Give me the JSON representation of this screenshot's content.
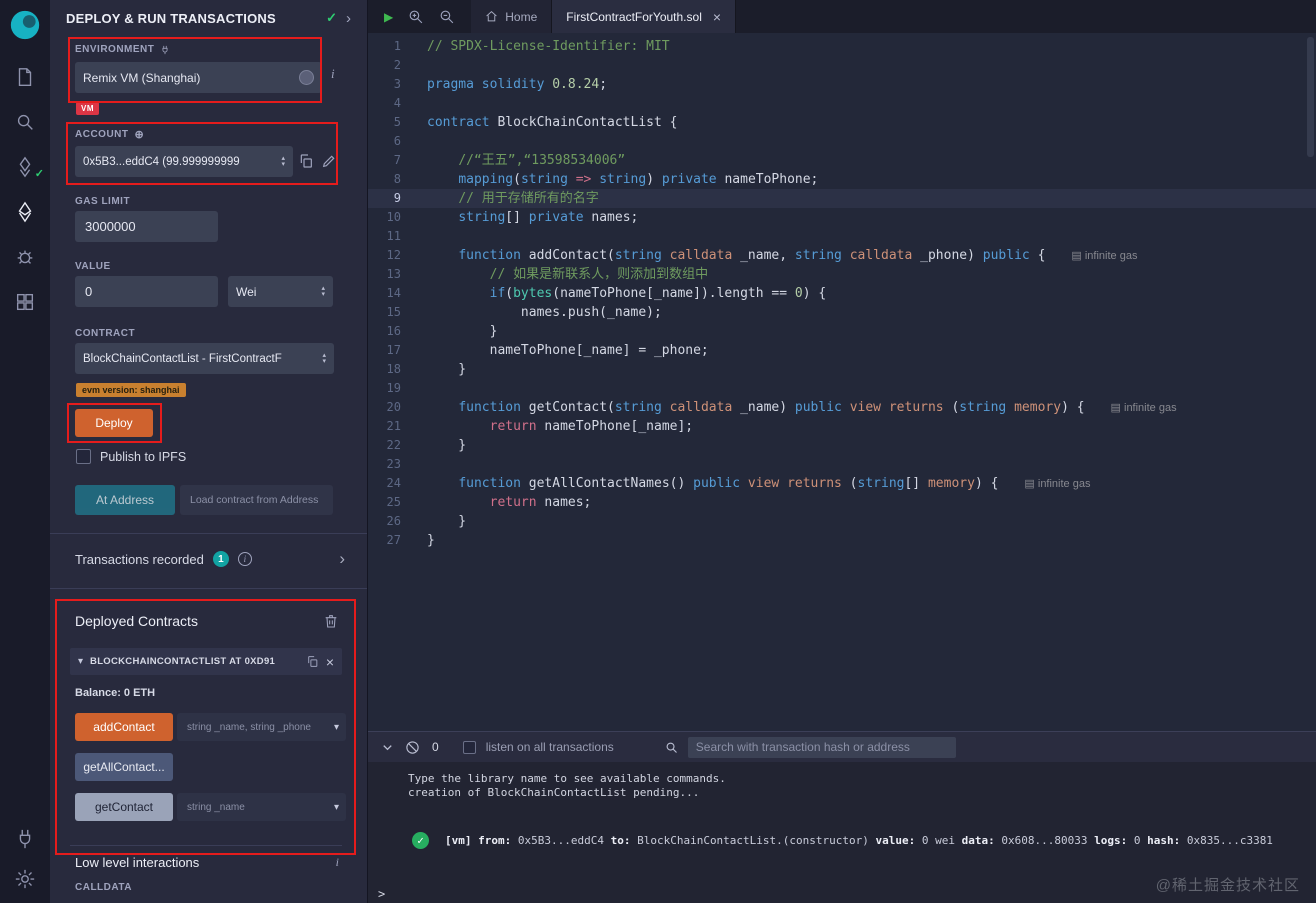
{
  "colors": {
    "annotation_red": "#e51c1c",
    "deploy_orange": "#cf622e",
    "at_address_teal": "#20778c",
    "count_badge_teal": "#12a3a3",
    "vm_badge_red": "#dc3545",
    "evm_badge_orange": "#c9802f",
    "success_green": "#27ae60",
    "keyword_blue": "#569cd6",
    "comment_green": "#6f9b5f",
    "string_orange": "#ce9178"
  },
  "activity_bar": {
    "icons": [
      "remix-logo",
      "file-explorer",
      "search",
      "solidity-compiler",
      "deploy-and-run",
      "debugger",
      "plugin-manager"
    ],
    "bottom_icons": [
      "remixd",
      "settings"
    ]
  },
  "panel": {
    "title": "DEPLOY & RUN TRANSACTIONS",
    "environment": {
      "label": "ENVIRONMENT",
      "value": "Remix VM (Shanghai)",
      "badge": "VM",
      "info_icon": "i"
    },
    "account": {
      "label": "ACCOUNT",
      "value": "0x5B3...eddC4 (99.999999999"
    },
    "gas_limit": {
      "label": "GAS LIMIT",
      "value": "3000000"
    },
    "value_field": {
      "label": "VALUE",
      "amount": "0",
      "unit": "Wei"
    },
    "contract_field": {
      "label": "CONTRACT",
      "value": "BlockChainContactList - FirstContractF",
      "evm_badge": "evm version: shanghai"
    },
    "deploy_label": "Deploy",
    "publish_label": "Publish to IPFS",
    "at_address_label": "At Address",
    "at_address_placeholder": "Load contract from Address",
    "transactions": {
      "label": "Transactions recorded",
      "count": "1"
    },
    "deployed": {
      "title": "Deployed Contracts",
      "instance": "BLOCKCHAINCONTACTLIST AT 0XD91",
      "balance": "Balance: 0 ETH",
      "functions": [
        {
          "label": "addContact",
          "params": "string _name, string _phone",
          "kind": "orange"
        },
        {
          "label": "getAllContact...",
          "params": "",
          "kind": "steel"
        },
        {
          "label": "getContact",
          "params": "string _name",
          "kind": "light"
        }
      ]
    },
    "low_level": {
      "title": "Low level interactions",
      "info": "i",
      "calldata_label": "CALLDATA"
    }
  },
  "tabs": {
    "items": [
      {
        "label": "Home"
      },
      {
        "label": "FirstContractForYouth.sol"
      }
    ]
  },
  "editor": {
    "lines": [
      {
        "n": 1,
        "t": [
          {
            "c": "cm",
            "s": "// SPDX-License-Identifier: MIT"
          }
        ]
      },
      {
        "n": 2,
        "t": []
      },
      {
        "n": 3,
        "t": [
          {
            "c": "kw",
            "s": "pragma solidity"
          },
          {
            "c": "pl",
            "s": " "
          },
          {
            "c": "nu",
            "s": "0.8.24"
          },
          {
            "c": "pl",
            "s": ";"
          }
        ]
      },
      {
        "n": 4,
        "t": []
      },
      {
        "n": 5,
        "t": [
          {
            "c": "kw",
            "s": "contract"
          },
          {
            "c": "pl",
            "s": " BlockChainContactList {"
          }
        ]
      },
      {
        "n": 6,
        "t": []
      },
      {
        "n": 7,
        "t": [
          {
            "c": "pl",
            "s": "    "
          },
          {
            "c": "cm",
            "s": "//“王五”,“13598534006”"
          }
        ]
      },
      {
        "n": 8,
        "t": [
          {
            "c": "pl",
            "s": "    "
          },
          {
            "c": "kw",
            "s": "mapping"
          },
          {
            "c": "pl",
            "s": "("
          },
          {
            "c": "kw",
            "s": "string"
          },
          {
            "c": "pl",
            "s": " "
          },
          {
            "c": "rt",
            "s": "=>"
          },
          {
            "c": "pl",
            "s": " "
          },
          {
            "c": "kw",
            "s": "string"
          },
          {
            "c": "pl",
            "s": ") "
          },
          {
            "c": "kw",
            "s": "private"
          },
          {
            "c": "pl",
            "s": " nameToPhone;"
          }
        ]
      },
      {
        "n": 9,
        "cur": true,
        "t": [
          {
            "c": "pl",
            "s": "    "
          },
          {
            "c": "cm",
            "s": "// 用于存储所有的名字"
          }
        ]
      },
      {
        "n": 10,
        "t": [
          {
            "c": "pl",
            "s": "    "
          },
          {
            "c": "kw",
            "s": "string"
          },
          {
            "c": "pl",
            "s": "[] "
          },
          {
            "c": "kw",
            "s": "private"
          },
          {
            "c": "pl",
            "s": " names;"
          }
        ]
      },
      {
        "n": 11,
        "t": []
      },
      {
        "n": 12,
        "gas": "infinite gas",
        "t": [
          {
            "c": "pl",
            "s": "    "
          },
          {
            "c": "kw",
            "s": "function"
          },
          {
            "c": "pl",
            "s": " addContact("
          },
          {
            "c": "kw",
            "s": "string"
          },
          {
            "c": "pl",
            "s": " "
          },
          {
            "c": "st",
            "s": "calldata"
          },
          {
            "c": "pl",
            "s": " _name, "
          },
          {
            "c": "kw",
            "s": "string"
          },
          {
            "c": "pl",
            "s": " "
          },
          {
            "c": "st",
            "s": "calldata"
          },
          {
            "c": "pl",
            "s": " _phone) "
          },
          {
            "c": "kw",
            "s": "public"
          },
          {
            "c": "pl",
            "s": " {"
          }
        ]
      },
      {
        "n": 13,
        "t": [
          {
            "c": "pl",
            "s": "        "
          },
          {
            "c": "cm",
            "s": "// 如果是新联系人，则添加到数组中"
          }
        ]
      },
      {
        "n": 14,
        "t": [
          {
            "c": "pl",
            "s": "        "
          },
          {
            "c": "kw",
            "s": "if"
          },
          {
            "c": "pl",
            "s": "("
          },
          {
            "c": "ty",
            "s": "bytes"
          },
          {
            "c": "pl",
            "s": "(nameToPhone[_name]).length == "
          },
          {
            "c": "nu",
            "s": "0"
          },
          {
            "c": "pl",
            "s": ") {"
          }
        ]
      },
      {
        "n": 15,
        "t": [
          {
            "c": "pl",
            "s": "            names.push(_name);"
          }
        ]
      },
      {
        "n": 16,
        "t": [
          {
            "c": "pl",
            "s": "        }"
          }
        ]
      },
      {
        "n": 17,
        "t": [
          {
            "c": "pl",
            "s": "        nameToPhone[_name] = _phone;"
          }
        ]
      },
      {
        "n": 18,
        "t": [
          {
            "c": "pl",
            "s": "    }"
          }
        ]
      },
      {
        "n": 19,
        "t": []
      },
      {
        "n": 20,
        "gas": "infinite gas",
        "t": [
          {
            "c": "pl",
            "s": "    "
          },
          {
            "c": "kw",
            "s": "function"
          },
          {
            "c": "pl",
            "s": " getContact("
          },
          {
            "c": "kw",
            "s": "string"
          },
          {
            "c": "pl",
            "s": " "
          },
          {
            "c": "st",
            "s": "calldata"
          },
          {
            "c": "pl",
            "s": " _name) "
          },
          {
            "c": "kw",
            "s": "public"
          },
          {
            "c": "pl",
            "s": " "
          },
          {
            "c": "st",
            "s": "view"
          },
          {
            "c": "pl",
            "s": " "
          },
          {
            "c": "st",
            "s": "returns"
          },
          {
            "c": "pl",
            "s": " ("
          },
          {
            "c": "kw",
            "s": "string"
          },
          {
            "c": "pl",
            "s": " "
          },
          {
            "c": "st",
            "s": "memory"
          },
          {
            "c": "pl",
            "s": ") {"
          }
        ]
      },
      {
        "n": 21,
        "t": [
          {
            "c": "pl",
            "s": "        "
          },
          {
            "c": "rt",
            "s": "return"
          },
          {
            "c": "pl",
            "s": " nameToPhone[_name];"
          }
        ]
      },
      {
        "n": 22,
        "t": [
          {
            "c": "pl",
            "s": "    }"
          }
        ]
      },
      {
        "n": 23,
        "t": []
      },
      {
        "n": 24,
        "gas": "infinite gas",
        "t": [
          {
            "c": "pl",
            "s": "    "
          },
          {
            "c": "kw",
            "s": "function"
          },
          {
            "c": "pl",
            "s": " getAllContactNames() "
          },
          {
            "c": "kw",
            "s": "public"
          },
          {
            "c": "pl",
            "s": " "
          },
          {
            "c": "st",
            "s": "view"
          },
          {
            "c": "pl",
            "s": " "
          },
          {
            "c": "st",
            "s": "returns"
          },
          {
            "c": "pl",
            "s": " ("
          },
          {
            "c": "kw",
            "s": "string"
          },
          {
            "c": "pl",
            "s": "[] "
          },
          {
            "c": "st",
            "s": "memory"
          },
          {
            "c": "pl",
            "s": ") {"
          }
        ]
      },
      {
        "n": 25,
        "t": [
          {
            "c": "pl",
            "s": "        "
          },
          {
            "c": "rt",
            "s": "return"
          },
          {
            "c": "pl",
            "s": " names;"
          }
        ]
      },
      {
        "n": 26,
        "t": [
          {
            "c": "pl",
            "s": "    }"
          }
        ]
      },
      {
        "n": 27,
        "t": [
          {
            "c": "pl",
            "s": "}"
          }
        ]
      }
    ]
  },
  "terminal": {
    "pending_count": "0",
    "listen_label": "listen on all transactions",
    "search_placeholder": "Search with transaction hash or address",
    "info_lines": [
      "Type the library name to see available commands.",
      "creation of BlockChainContactList pending..."
    ],
    "tx_segments": [
      {
        "b": true,
        "s": "[vm]"
      },
      {
        "b": true,
        "s": " from:"
      },
      {
        "b": false,
        "s": " 0x5B3...eddC4 "
      },
      {
        "b": true,
        "s": "to:"
      },
      {
        "b": false,
        "s": " BlockChainContactList.(constructor) "
      },
      {
        "b": true,
        "s": "value:"
      },
      {
        "b": false,
        "s": " 0 wei "
      },
      {
        "b": true,
        "s": "data:"
      },
      {
        "b": false,
        "s": " 0x608...80033 "
      },
      {
        "b": true,
        "s": "logs:"
      },
      {
        "b": false,
        "s": " 0 "
      },
      {
        "b": true,
        "s": "hash:"
      },
      {
        "b": false,
        "s": " 0x835...c3381"
      }
    ],
    "watermark": "@稀土掘金技术社区",
    "prompt": ">"
  }
}
